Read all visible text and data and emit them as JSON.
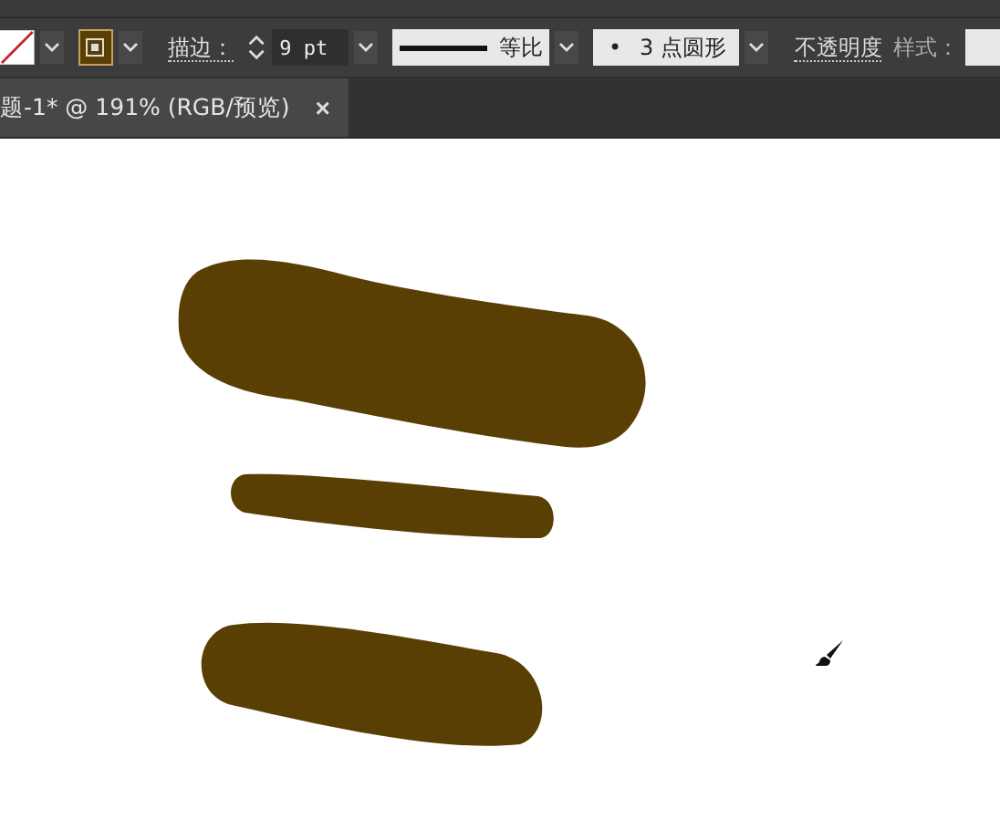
{
  "control_bar": {
    "stroke_label": "描边：",
    "stroke_weight": "9 pt",
    "stroke_profile": "等比",
    "brush": {
      "bullet": "•",
      "text": "3 点圆形"
    },
    "opacity_label": "不透明度",
    "style_label": "样式："
  },
  "tabs": [
    {
      "label": "题-1* @ 191% (RGB/预览)",
      "close": "×",
      "selected": true
    }
  ],
  "canvas": {
    "strokes": [
      {
        "kind": "thick",
        "color": "#5a3f05"
      },
      {
        "kind": "thin",
        "color": "#5a3f05"
      },
      {
        "kind": "medium",
        "color": "#5a3f05"
      }
    ]
  }
}
